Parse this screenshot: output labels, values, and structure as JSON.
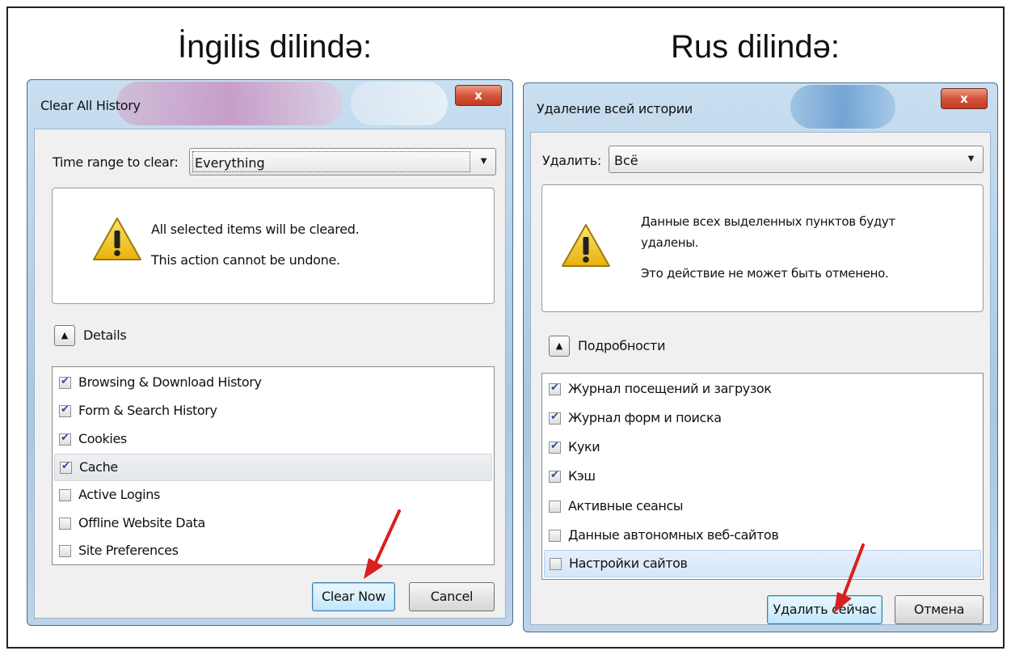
{
  "headings": {
    "english": "İngilis dilində:",
    "russian": "Rus dilində:"
  },
  "dialogs": [
    {
      "title": "Clear All History",
      "close_label": "x",
      "range_label": "Time range to clear:",
      "range_value": "Everything",
      "warning_line1": "All selected items will be cleared.",
      "warning_line2": "This action cannot be undone.",
      "details_label": "Details",
      "items": [
        {
          "label": "Browsing & Download History",
          "checked": true
        },
        {
          "label": "Form & Search History",
          "checked": true
        },
        {
          "label": "Cookies",
          "checked": true
        },
        {
          "label": "Cache",
          "checked": true
        },
        {
          "label": "Active Logins",
          "checked": false
        },
        {
          "label": "Offline Website Data",
          "checked": false
        },
        {
          "label": "Site Preferences",
          "checked": false
        }
      ],
      "primary_button": "Clear Now",
      "cancel_button": "Cancel"
    },
    {
      "title": "Удаление всей истории",
      "close_label": "x",
      "range_label": "Удалить:",
      "range_value": "Всё",
      "warning_line1": "Данные всех выделенных пунктов будут",
      "warning_line1b": "удалены.",
      "warning_line2": "Это действие не может быть отменено.",
      "details_label": "Подробности",
      "items": [
        {
          "label": "Журнал посещений и загрузок",
          "checked": true
        },
        {
          "label": "Журнал форм и поиска",
          "checked": true
        },
        {
          "label": "Куки",
          "checked": true
        },
        {
          "label": "Кэш",
          "checked": true
        },
        {
          "label": "Активные сеансы",
          "checked": false
        },
        {
          "label": "Данные автономных веб-сайтов",
          "checked": false
        },
        {
          "label": "Настройки сайтов",
          "checked": false
        }
      ],
      "primary_button": "Удалить сейчас",
      "cancel_button": "Отмена"
    }
  ],
  "colors": {
    "annotation_arrow": "#d9201e",
    "warning_icon": "#f2c811"
  }
}
